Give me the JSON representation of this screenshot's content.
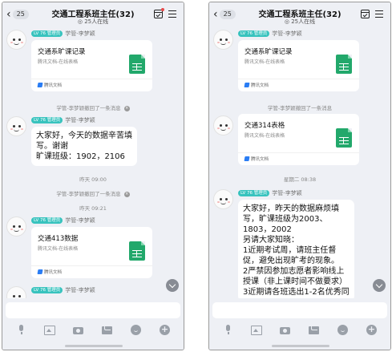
{
  "colors": {
    "background": "#eef0f5",
    "level_badge": "#38c3be",
    "sheet_icon": "#22a86b",
    "unread_dot": "#e84a4a"
  },
  "screens": [
    {
      "back_count": "25",
      "title": "交通工程系班主任(32)",
      "online": "◎ 25人在线",
      "items": [
        {
          "kind": "card",
          "badge": "LV 76 管理员",
          "sender": "学管-李梦颖",
          "title": "交通系旷课记录",
          "subtitle": "腾讯文档-在线表格",
          "footer": "腾讯文档"
        },
        {
          "kind": "system",
          "text": "学管-李梦颖撤回了一条消息"
        },
        {
          "kind": "text",
          "badge": "LV 76 管理员",
          "sender": "学管-李梦颖",
          "lines": [
            "大家好，今天的数据辛苦填",
            "写。谢谢",
            "旷课班级：1902，2106"
          ]
        },
        {
          "kind": "time",
          "text": "昨天 09:00"
        },
        {
          "kind": "system",
          "text": "学管-李梦颖撤回了一条消息"
        },
        {
          "kind": "time",
          "text": "昨天 09:21"
        },
        {
          "kind": "card",
          "badge": "LV 76 管理员",
          "sender": "学管-李梦颖",
          "title": "交通413数据",
          "subtitle": "腾讯文档-在线表格",
          "footer": "腾讯文档"
        },
        {
          "kind": "sender_only",
          "badge": "LV 76 管理员",
          "sender": "学管-李梦颖"
        }
      ]
    },
    {
      "back_count": "25",
      "title": "交通工程系班主任(32)",
      "online": "◎ 25人在线",
      "items": [
        {
          "kind": "card",
          "badge": "LV 76 管理员",
          "sender": "学管-李梦颖",
          "title": "交通系旷课记录",
          "subtitle": "腾讯文档-在线表格",
          "footer": "腾讯文档"
        },
        {
          "kind": "system",
          "text": "学管-李梦颖撤回了一条消息"
        },
        {
          "kind": "card",
          "badge": "",
          "sender": "学管-李梦颖",
          "title": "交通314表格",
          "subtitle": "腾讯文档-在线表格",
          "footer": "腾讯文档"
        },
        {
          "kind": "time",
          "text": "星期二 08:38"
        },
        {
          "kind": "text",
          "badge": "LV 76 管理员",
          "sender": "学管-李梦颖",
          "lines": [
            "大家好，昨天的数据麻烦填",
            "写，旷课班级为2003、",
            "1803，2002",
            "另请大家知晓：",
            "1近期考试周，请班主任督",
            "促，避免出现旷考的现象。",
            "2严禁因参加志愿者影响线上",
            "授课（非上课时间不做要求）",
            "3近期请各班选出1-2名优秀同"
          ]
        }
      ]
    }
  ]
}
